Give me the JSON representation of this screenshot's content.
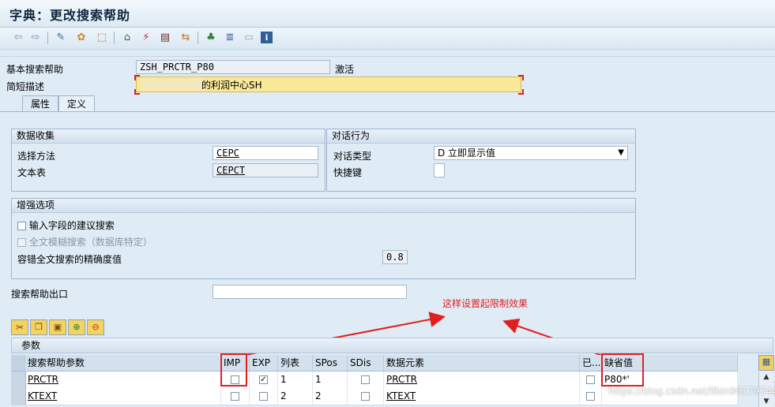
{
  "window": {
    "title": "字典：更改搜索帮助"
  },
  "toolbar": {
    "icons": [
      "back-arrow-icon",
      "forward-arrow-icon",
      "other-object-icon",
      "display-change-icon",
      "activate-icon",
      "check-icon",
      "test-icon",
      "where-used-icon",
      "object-list-icon",
      "hierarchy-icon",
      "documentation-icon",
      "info-icon"
    ]
  },
  "header": {
    "basic_help_label": "基本搜索帮助",
    "basic_help_value": "ZSH_PRCTR_P80",
    "status": "激活",
    "short_desc_label": "简短描述",
    "short_desc_value": "的利润中心SH"
  },
  "tabs": [
    {
      "label": "属性"
    },
    {
      "label": "定义"
    }
  ],
  "data_collection": {
    "title": "数据收集",
    "selection_method_label": "选择方法",
    "selection_method_value": "CEPC",
    "text_table_label": "文本表",
    "text_table_value": "CEPCT"
  },
  "dialog_behavior": {
    "title": "对话行为",
    "dialog_type_label": "对话类型",
    "dialog_type_value": "D 立即显示值",
    "hotkey_label": "快捷键",
    "hotkey_value": ""
  },
  "enhanced_options": {
    "title": "增强选项",
    "proposal_search_label": "输入字段的建议搜索",
    "fulltext_fuzzy_label": "全文模糊搜索（数据库特定）",
    "accuracy_label": "容错全文搜索的精确度值",
    "accuracy_value": "0.8"
  },
  "exit": {
    "label": "搜索帮助出口",
    "value": ""
  },
  "annotation": {
    "text": "这样设置起限制效果",
    "color": "#e02020"
  },
  "params": {
    "title": "参数",
    "columns": [
      "搜索帮助参数",
      "IMP",
      "EXP",
      "列表",
      "SPos",
      "SDis",
      "数据元素",
      "已...",
      "缺省值"
    ],
    "rows": [
      {
        "param": "PRCTR",
        "imp": false,
        "exp": true,
        "list": "1",
        "spos": "1",
        "sdis": false,
        "element": "PRCTR",
        "modified": false,
        "default": "P80*'"
      },
      {
        "param": "KTEXT",
        "imp": false,
        "exp": false,
        "list": "2",
        "spos": "2",
        "sdis": false,
        "element": "KTEXT",
        "modified": false,
        "default": ""
      }
    ]
  },
  "watermark": "https://blog.csdn.net/libin961797440"
}
